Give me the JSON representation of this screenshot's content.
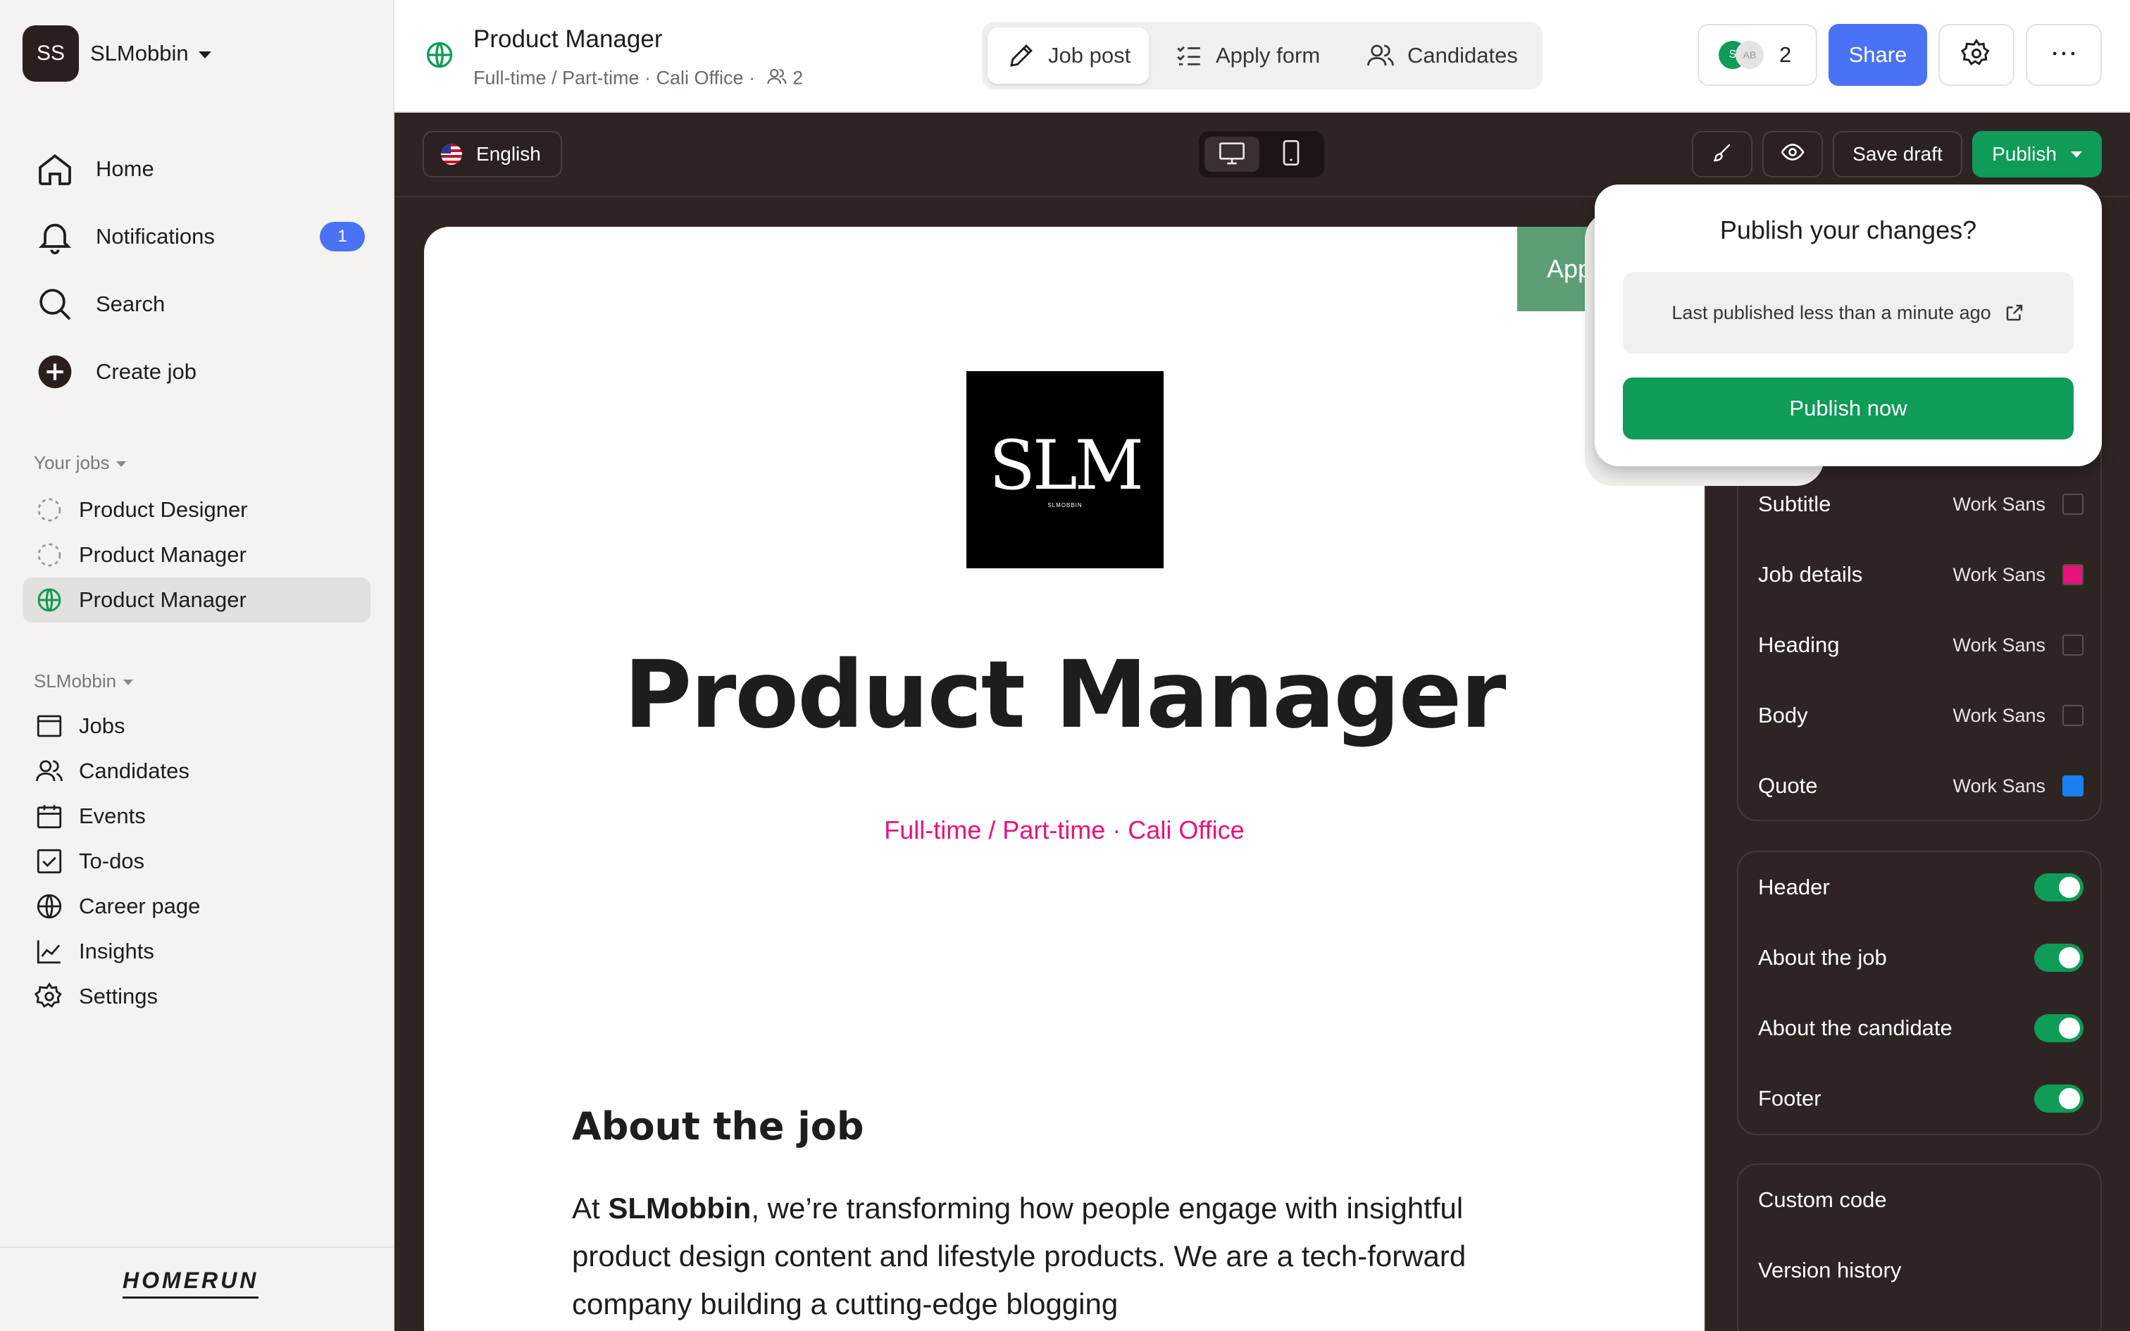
{
  "workspace": {
    "initials": "SS",
    "name": "SLMobbin"
  },
  "nav": {
    "home": "Home",
    "notifications": "Notifications",
    "notifications_count": "1",
    "search": "Search",
    "create_job": "Create job"
  },
  "your_jobs": {
    "label": "Your jobs",
    "items": [
      {
        "label": "Product Designer",
        "status": "draft"
      },
      {
        "label": "Product Manager",
        "status": "draft"
      },
      {
        "label": "Product Manager",
        "status": "published"
      }
    ]
  },
  "org": {
    "label": "SLMobbin",
    "items": [
      {
        "label": "Jobs",
        "icon": "browser-icon"
      },
      {
        "label": "Candidates",
        "icon": "users-icon"
      },
      {
        "label": "Events",
        "icon": "calendar-icon"
      },
      {
        "label": "To-dos",
        "icon": "checkbox-icon"
      },
      {
        "label": "Career page",
        "icon": "globe-icon"
      },
      {
        "label": "Insights",
        "icon": "chart-icon"
      },
      {
        "label": "Settings",
        "icon": "gear-icon"
      }
    ]
  },
  "brand": "HOMERUN",
  "header": {
    "title": "Product Manager",
    "subtitle": "Full-time / Part-time · Cali Office ·",
    "candidate_count": "2",
    "tabs": [
      {
        "label": "Job post",
        "active": true
      },
      {
        "label": "Apply form",
        "active": false
      },
      {
        "label": "Candidates",
        "active": false
      }
    ],
    "collaborator_count": "2",
    "collaborator_initials": [
      "S",
      "AB"
    ],
    "share": "Share"
  },
  "editor": {
    "language": "English",
    "save_draft": "Save draft",
    "publish": "Publish"
  },
  "canvas": {
    "apply_tab": "Apply",
    "logo_text": "SLM",
    "logo_small": "SLMOBBIN",
    "title": "Product Manager",
    "subtitle": "Full-time / Part-time · Cali Office",
    "about_heading": "About the job",
    "about_intro": "At",
    "about_company": "SLMobbin",
    "about_rest": ", we’re transforming how people engage with insightful product design content and lifestyle products. We are a tech-forward company building a cutting-edge blogging"
  },
  "panel": {
    "fonts": [
      {
        "label": "Subtitle",
        "font": "Work Sans",
        "color": "#2a2120"
      },
      {
        "label": "Job details",
        "font": "Work Sans",
        "color": "#e8127c"
      },
      {
        "label": "Heading",
        "font": "Work Sans",
        "color": "#2a2120"
      },
      {
        "label": "Body",
        "font": "Work Sans",
        "color": "#2a2120"
      },
      {
        "label": "Quote",
        "font": "Work Sans",
        "color": "#1a7ff0"
      }
    ],
    "sections": [
      {
        "label": "Header",
        "on": true
      },
      {
        "label": "About the job",
        "on": true
      },
      {
        "label": "About the candidate",
        "on": true
      },
      {
        "label": "Footer",
        "on": true
      }
    ],
    "custom_code": "Custom code",
    "version_history": "Version history"
  },
  "popover": {
    "title": "Publish your changes?",
    "info": "Last published less than a minute ago",
    "button": "Publish now"
  },
  "colors": {
    "accent_blue": "#4a72f5",
    "publish_green": "#0f9b58",
    "job_details_pink": "#e8127c",
    "editor_bg": "#2e2422"
  }
}
